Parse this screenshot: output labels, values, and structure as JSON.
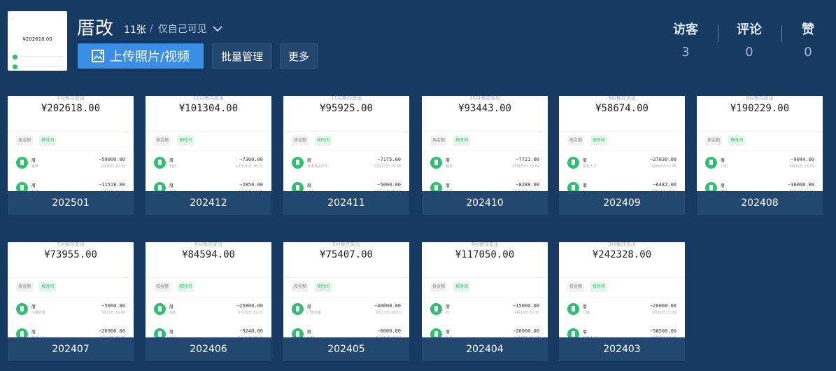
{
  "album": {
    "title": "厝改",
    "count": "11张",
    "privacy": "仅自己可见",
    "cover": {
      "month_label": "1月餐共支出",
      "amount": "¥202618.00"
    }
  },
  "toolbar": {
    "upload_label": "上传照片/视频",
    "batch_label": "批量管理",
    "more_label": "更多"
  },
  "stats": {
    "visitors_label": "访客",
    "visitors_value": "3",
    "comments_label": "评论",
    "comments_value": "0",
    "likes_label": "赞",
    "likes_value": "0"
  },
  "photos": [
    {
      "caption": "202501",
      "subtitle": "1月餐共支出",
      "amount": "¥202618.00",
      "tab_a": "按金额",
      "tab_b": "按时间",
      "rows": [
        {
          "name": "厝",
          "note": "装修",
          "amount": "−59000.00",
          "date": "1月26日 18:39"
        },
        {
          "name": "厝",
          "note": "石材",
          "amount": "−11518.00",
          "date": "1月24日 15:22"
        }
      ]
    },
    {
      "caption": "202412",
      "subtitle": "12月餐共支出",
      "amount": "¥101304.00",
      "tab_a": "按金额",
      "tab_b": "按时间",
      "rows": [
        {
          "name": "厝",
          "note": "石材",
          "amount": "−7360.00",
          "date": "12月25日 16:31"
        },
        {
          "name": "厝",
          "note": "水泥",
          "amount": "−2850.00",
          "date": "12月20日 11:08"
        }
      ]
    },
    {
      "caption": "202411",
      "subtitle": "11月餐共支出",
      "amount": "¥95925.00",
      "tab_a": "按金额",
      "tab_b": "按时间",
      "rows": [
        {
          "name": "厝",
          "note": "水泥石头沙子",
          "amount": "−7175.00",
          "date": "11月27日 15:58"
        },
        {
          "name": "厝",
          "note": "小工",
          "amount": "−5000.00",
          "date": "11月22日 09:10"
        }
      ]
    },
    {
      "caption": "202410",
      "subtitle": "10月餐共支出",
      "amount": "¥93443.00",
      "tab_a": "按金额",
      "tab_b": "按时间",
      "rows": [
        {
          "name": "厝",
          "note": "钢材",
          "amount": "−7721.00",
          "date": "10月30日 19:41"
        },
        {
          "name": "厝",
          "note": "水泥",
          "amount": "−8288.00",
          "date": "10月25日 08:22"
        }
      ]
    },
    {
      "caption": "202409",
      "subtitle": "9月餐共支出",
      "amount": "¥58674.00",
      "tab_a": "按金额",
      "tab_b": "按时间",
      "rows": [
        {
          "name": "厝",
          "note": "挖机人工",
          "amount": "−27830.00",
          "date": "9月14日 15:05"
        },
        {
          "name": "厝",
          "note": "石",
          "amount": "−6482.00",
          "date": "9月10日 10:12"
        }
      ]
    },
    {
      "caption": "202408",
      "subtitle": "8月餐共支出",
      "amount": "¥190229.00",
      "tab_a": "按金额",
      "tab_b": "按时间",
      "rows": [
        {
          "name": "厝",
          "note": "沙石",
          "amount": "−9044.00",
          "date": "8月31日 16:59"
        },
        {
          "name": "厝",
          "note": "钢筋",
          "amount": "−30000.00",
          "date": "8月22日 12:30"
        }
      ]
    },
    {
      "caption": "202407",
      "subtitle": "7月餐共支出",
      "amount": "¥73955.00",
      "tab_a": "按金额",
      "tab_b": "按时间",
      "rows": [
        {
          "name": "厝",
          "note": "小额定金",
          "amount": "−5000.00",
          "date": "7月19日 19:48"
        },
        {
          "name": "厝",
          "note": "建材人工",
          "amount": "−26960.00",
          "date": "7月12日 10:05"
        }
      ]
    },
    {
      "caption": "202406",
      "subtitle": "6月餐共支出",
      "amount": "¥84594.00",
      "tab_a": "按金额",
      "tab_b": "按时间",
      "rows": [
        {
          "name": "厝",
          "note": "挖机",
          "amount": "−25800.00",
          "date": "6月19日 22:21"
        },
        {
          "name": "厝",
          "note": "水泥",
          "amount": "−9240.00",
          "date": "6月10日 09:40"
        }
      ]
    },
    {
      "caption": "202405",
      "subtitle": "5月餐共支出",
      "amount": "¥75407.00",
      "tab_a": "按金额",
      "tab_b": "按时间",
      "rows": [
        {
          "name": "厝",
          "note": "门窗定金",
          "amount": "−40000.00",
          "date": "5月21日 18:53"
        },
        {
          "name": "厝",
          "note": "木材",
          "amount": "−6000.00",
          "date": "5月15日 14:22"
        }
      ]
    },
    {
      "caption": "202404",
      "subtitle": "4月餐共支出",
      "amount": "¥117050.00",
      "tab_a": "按金额",
      "tab_b": "按时间",
      "rows": [
        {
          "name": "厝",
          "note": "石",
          "amount": "−15000.00",
          "date": "4月29日 20:35"
        },
        {
          "name": "厝",
          "note": "人工",
          "amount": "−20000.00",
          "date": "4月18日 11:11"
        }
      ]
    },
    {
      "caption": "202403",
      "subtitle": "3月餐共支出",
      "amount": "¥242328.00",
      "tab_a": "按金额",
      "tab_b": "按时间",
      "rows": [
        {
          "name": "厝",
          "note": "门窗",
          "amount": "−20000.00",
          "date": "3月31日 23:21"
        },
        {
          "name": "厝",
          "note": "装修人工",
          "amount": "−58500.00",
          "date": "3月20日 10:40"
        }
      ]
    }
  ]
}
